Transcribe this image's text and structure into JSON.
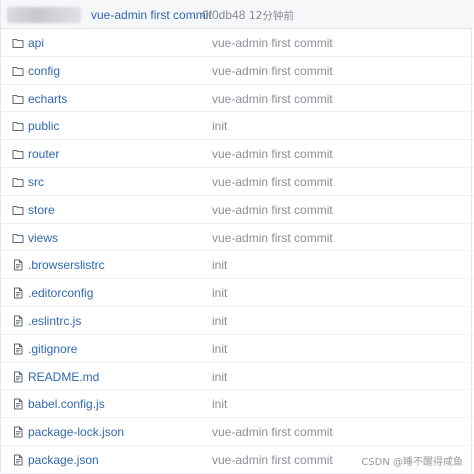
{
  "header": {
    "commit_message": "vue-admin first commit",
    "commit_hash": "0f0db48",
    "commit_time": "12分钟前"
  },
  "files": [
    {
      "name": "api",
      "type": "folder",
      "message": "vue-admin first commit"
    },
    {
      "name": "config",
      "type": "folder",
      "message": "vue-admin first commit"
    },
    {
      "name": "echarts",
      "type": "folder",
      "message": "vue-admin first commit"
    },
    {
      "name": "public",
      "type": "folder",
      "message": "init"
    },
    {
      "name": "router",
      "type": "folder",
      "message": "vue-admin first commit"
    },
    {
      "name": "src",
      "type": "folder",
      "message": "vue-admin first commit"
    },
    {
      "name": "store",
      "type": "folder",
      "message": "vue-admin first commit"
    },
    {
      "name": "views",
      "type": "folder",
      "message": "vue-admin first commit"
    },
    {
      "name": ".browserslistrc",
      "type": "file",
      "message": "init"
    },
    {
      "name": ".editorconfig",
      "type": "file",
      "message": "init"
    },
    {
      "name": ".eslintrc.js",
      "type": "file",
      "message": "init"
    },
    {
      "name": ".gitignore",
      "type": "file",
      "message": "init"
    },
    {
      "name": "README.md",
      "type": "file",
      "message": "init"
    },
    {
      "name": "babel.config.js",
      "type": "file",
      "message": "init"
    },
    {
      "name": "package-lock.json",
      "type": "file",
      "message": "vue-admin first commit"
    },
    {
      "name": "package.json",
      "type": "file",
      "message": "vue-admin first commit"
    }
  ],
  "watermark": "CSDN @睡不醒得咸鱼",
  "colors": {
    "link": "#2f68b1",
    "muted": "#8a8f98",
    "header_bg": "#f6f7f9",
    "border": "#e4e6eb"
  }
}
